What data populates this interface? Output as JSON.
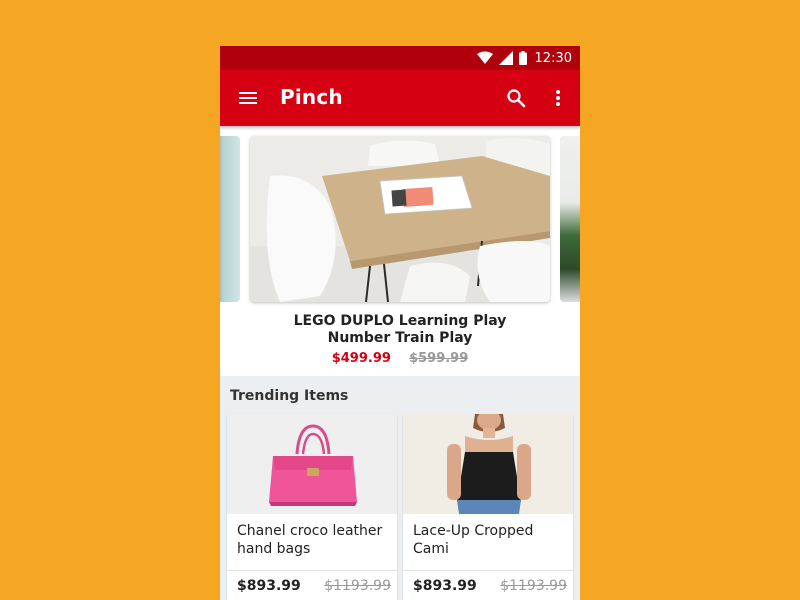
{
  "colors": {
    "background": "#F5A623",
    "primary": "#D50012",
    "status_bar": "#B0000E",
    "price": "#D50012",
    "strike": "#9a9a9a"
  },
  "status_bar": {
    "time": "12:30",
    "icons": [
      "wifi-icon",
      "signal-icon",
      "battery-icon"
    ]
  },
  "app_bar": {
    "title": "Pinch",
    "icons": [
      "menu-icon",
      "search-icon",
      "more-vert-icon"
    ]
  },
  "featured": {
    "title_line1": "LEGO DUPLO Learning Play",
    "title_line2": "Number Train Play",
    "price": "$499.99",
    "original_price": "$599.99"
  },
  "trending": {
    "title": "Trending Items",
    "items": [
      {
        "name": "Chanel croco leather hand bags",
        "price": "$893.99",
        "original_price": "$1193.99"
      },
      {
        "name": "Lace-Up Cropped Cami",
        "price": "$893.99",
        "original_price": "$1193.99"
      }
    ]
  }
}
